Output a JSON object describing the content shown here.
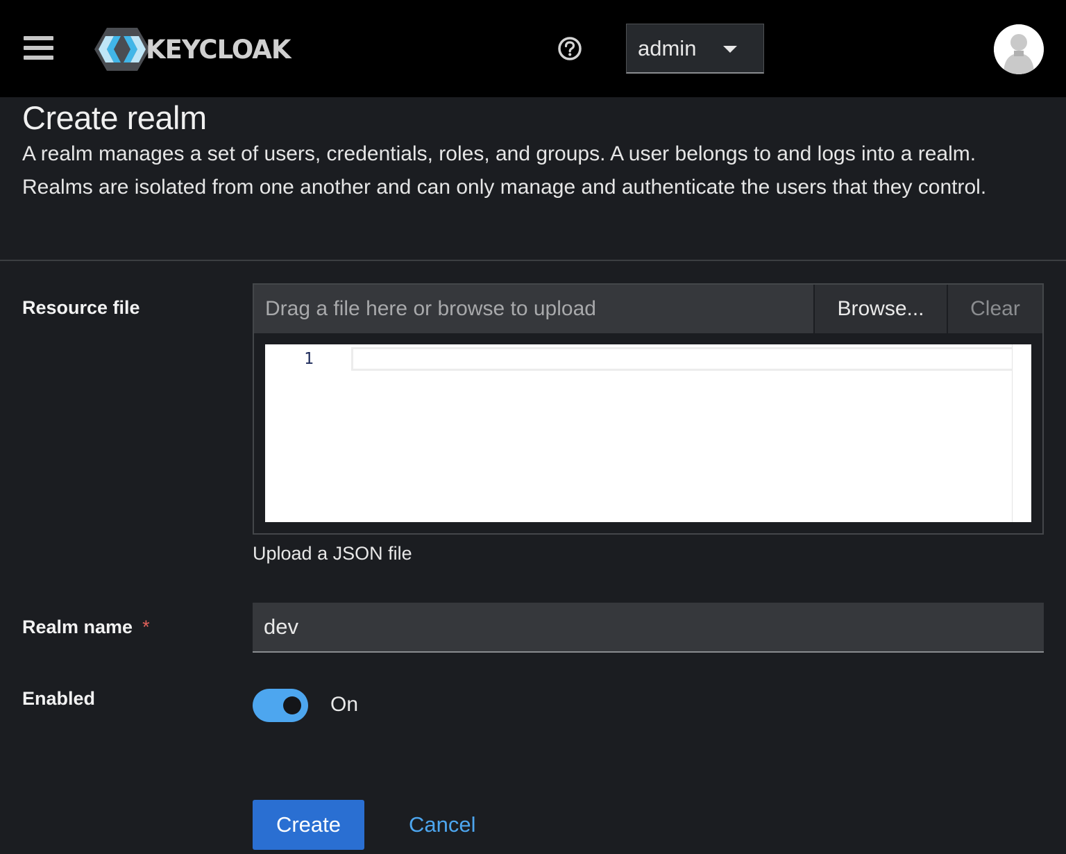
{
  "masthead": {
    "menu_icon": "hamburger-menu-icon",
    "brand_text": "KEYCLOAK",
    "help_icon": "question-circle-icon",
    "user_menu": {
      "label": "admin",
      "caret_icon": "caret-down-icon"
    },
    "avatar_icon": "user-avatar-icon"
  },
  "header": {
    "title": "Create realm",
    "description": "A realm manages a set of users, credentials, roles, and groups. A user belongs to and logs into a realm. Realms are isolated from one another and can only manage and authenticate the users that they control."
  },
  "form": {
    "resource_file": {
      "label": "Resource file",
      "placeholder": "Drag a file here or browse to upload",
      "browse_label": "Browse...",
      "clear_label": "Clear",
      "editor_line_number": "1",
      "helper_text": "Upload a JSON file"
    },
    "realm_name": {
      "label": "Realm name",
      "required_marker": "*",
      "value": "dev"
    },
    "enabled": {
      "label": "Enabled",
      "state": "On",
      "checked": true
    },
    "actions": {
      "create_label": "Create",
      "cancel_label": "Cancel"
    }
  },
  "colors": {
    "masthead_bg": "#000000",
    "page_bg": "#1b1d21",
    "primary": "#2a6fd2",
    "link": "#4da6ef",
    "switch_on": "#4da6ef",
    "required": "#e0605a"
  }
}
